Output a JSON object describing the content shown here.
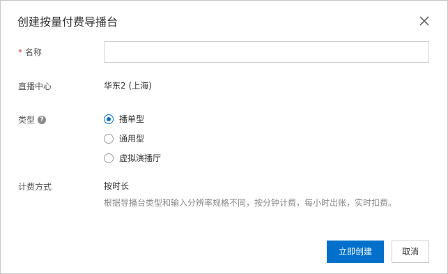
{
  "dialog": {
    "title": "创建按量付费导播台",
    "close_icon": "close-icon"
  },
  "form": {
    "name": {
      "required_mark": "*",
      "label": "名称",
      "value": "",
      "placeholder": ""
    },
    "center": {
      "label": "直播中心",
      "value": "华东2 (上海)"
    },
    "type": {
      "label": "类型",
      "help_icon": "question-circle-icon",
      "help_glyph": "?",
      "selected": "播单型",
      "options": [
        "播单型",
        "通用型",
        "虚拟演播厅"
      ]
    },
    "billing": {
      "label": "计费方式",
      "value": "按时长",
      "hint": "根据导播台类型和输入分辨率规格不同，按分钟计费，每小时出账，实时扣费。"
    }
  },
  "footer": {
    "confirm_label": "立即创建",
    "cancel_label": "取消"
  },
  "colors": {
    "primary": "#0070cc",
    "required": "#e4393c",
    "hint_text": "#888888"
  }
}
